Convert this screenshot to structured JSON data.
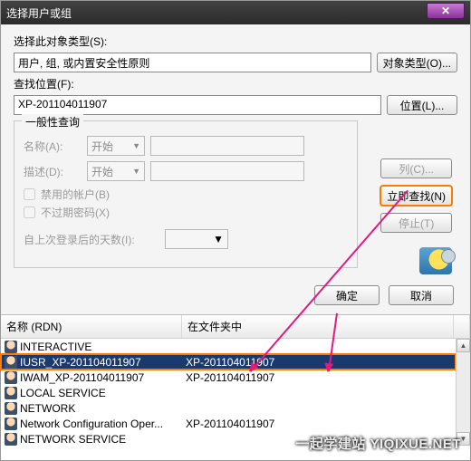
{
  "titlebar": {
    "title": "选择用户或组"
  },
  "section": {
    "object_type_label": "选择此对象类型(S):",
    "object_type_value": "用户, 组, 或内置安全性原则",
    "object_type_btn": "对象类型(O)...",
    "location_label": "查找位置(F):",
    "location_value": "XP-201104011907",
    "location_btn": "位置(L)..."
  },
  "query": {
    "legend": "一般性查询",
    "name_label": "名称(A):",
    "desc_label": "描述(D):",
    "combo_option": "开始",
    "chk_disabled": "禁用的帐户(B)",
    "chk_noexpire": "不过期密码(X)",
    "days_label": "自上次登录后的天数(I):"
  },
  "side": {
    "columns_btn": "列(C)...",
    "findnow_btn": "立即查找(N)",
    "stop_btn": "停止(T)"
  },
  "okcancel": {
    "ok": "确定",
    "cancel": "取消"
  },
  "list": {
    "col_name": "名称 (RDN)",
    "col_folder": "在文件夹中",
    "rows": [
      {
        "name": "INTERACTIVE",
        "folder": ""
      },
      {
        "name": "IUSR_XP-201104011907",
        "folder": "XP-201104011907"
      },
      {
        "name": "IWAM_XP-201104011907",
        "folder": "XP-201104011907"
      },
      {
        "name": "LOCAL SERVICE",
        "folder": ""
      },
      {
        "name": "NETWORK",
        "folder": ""
      },
      {
        "name": "Network Configuration Oper...",
        "folder": "XP-201104011907"
      },
      {
        "name": "NETWORK SERVICE",
        "folder": ""
      }
    ],
    "selected_index": 1
  },
  "watermark": "一起学建站 YIQIXUE.NET"
}
